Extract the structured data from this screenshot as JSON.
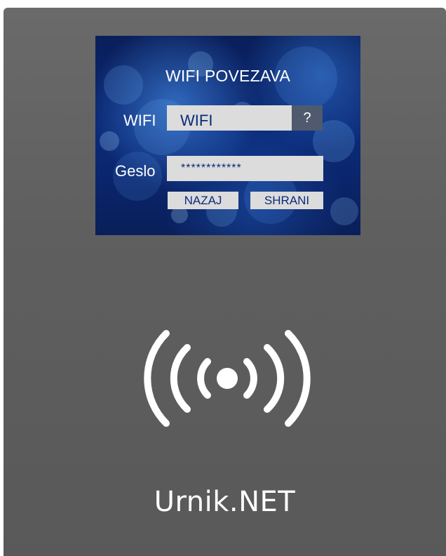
{
  "screen": {
    "title": "WIFI POVEZAVA",
    "wifi_label": "WIFI",
    "wifi_value": "WIFI",
    "help_label": "?",
    "password_label": "Geslo",
    "password_value": "************",
    "back_button": "NAZAJ",
    "save_button": "SHRANI"
  },
  "brand": {
    "name": "Urnik.NET"
  },
  "icons": {
    "contactless": "nfc-icon"
  },
  "colors": {
    "device_body": "#5f5f5f",
    "screen_background": "#0b2a78",
    "field_background": "#dcdcdc",
    "field_text": "#0b2a78",
    "help_background": "#4f5a6e"
  }
}
